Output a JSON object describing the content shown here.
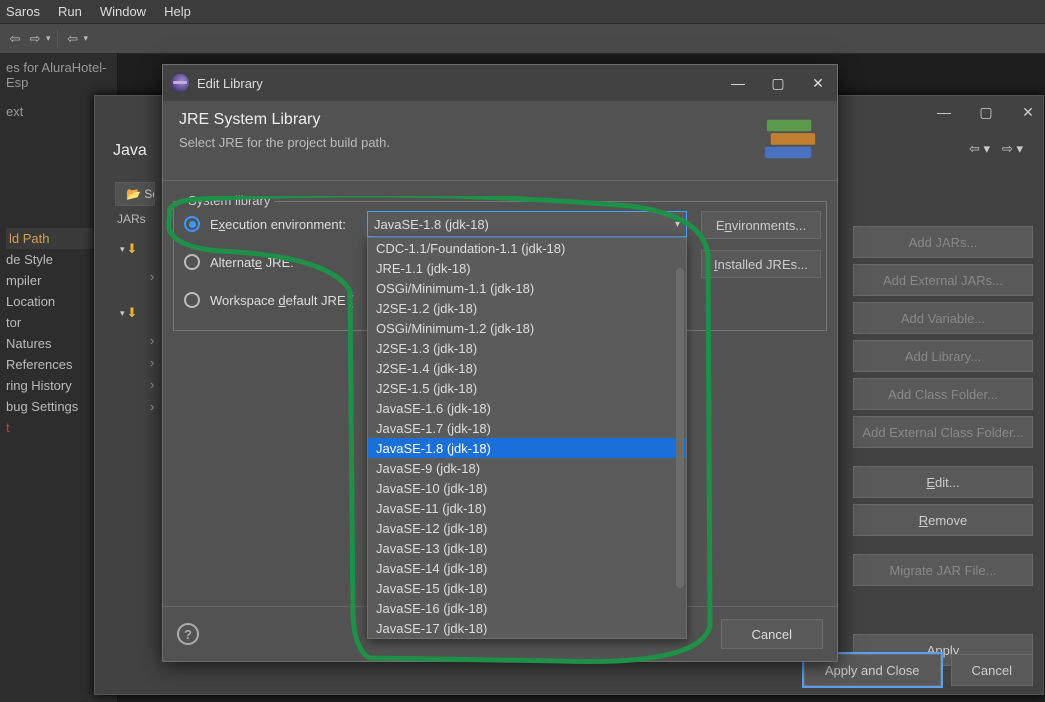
{
  "menubar": {
    "items": [
      "Saros",
      "Run",
      "Window",
      "Help"
    ]
  },
  "leftpanel": {
    "header1": "es for AluraHotel-Esp",
    "header2": "ext",
    "items": [
      "",
      "ld Path",
      "de Style",
      "mpiler",
      " Location",
      "tor",
      "Natures",
      "References",
      "ring History",
      "bug Settings"
    ],
    "marker": "t"
  },
  "bgwin": {
    "tablabel": "Java ",
    "srctab": "📂 Sc",
    "jarstxt": "JARs",
    "buttons": {
      "addjars": "Add JARs...",
      "addext": "Add External JARs...",
      "addvar": "Add Variable...",
      "addlib": "Add Library...",
      "addcls": "Add Class Folder...",
      "addextcls": "Add External Class Folder...",
      "edit": "Edit...",
      "remove": "Remove",
      "migrate": "Migrate JAR File..."
    },
    "applyclose": "Apply and Close",
    "cancel": "Cancel",
    "apply": "Apply"
  },
  "dlg": {
    "title": "Edit Library",
    "heading": "JRE System Library",
    "desc": "Select JRE for the project build path.",
    "fieldset": "System library",
    "radio1_pre": "E",
    "radio1_hot": "x",
    "radio1_post": "ecution environment:",
    "radio2_pre": "Alternat",
    "radio2_hot": "e",
    "radio2_post": " JRE:",
    "radio3_pre": "Workspace ",
    "radio3_hot": "d",
    "radio3_post": "efault JRE (",
    "combovalue": "JavaSE-1.8 (jdk-18)",
    "envbtn_pre": "E",
    "envbtn_hot": "n",
    "envbtn_post": "vironments...",
    "instbtn_pre": "",
    "instbtn_hot": "I",
    "instbtn_post": "nstalled JREs...",
    "options": [
      "CDC-1.1/Foundation-1.1 (jdk-18)",
      "JRE-1.1 (jdk-18)",
      "OSGi/Minimum-1.1 (jdk-18)",
      "J2SE-1.2 (jdk-18)",
      "OSGi/Minimum-1.2 (jdk-18)",
      "J2SE-1.3 (jdk-18)",
      "J2SE-1.4 (jdk-18)",
      "J2SE-1.5 (jdk-18)",
      "JavaSE-1.6 (jdk-18)",
      "JavaSE-1.7 (jdk-18)",
      "JavaSE-1.8 (jdk-18)",
      "JavaSE-9 (jdk-18)",
      "JavaSE-10 (jdk-18)",
      "JavaSE-11 (jdk-18)",
      "JavaSE-12 (jdk-18)",
      "JavaSE-13 (jdk-18)",
      "JavaSE-14 (jdk-18)",
      "JavaSE-15 (jdk-18)",
      "JavaSE-16 (jdk-18)",
      "JavaSE-17 (jdk-18)"
    ],
    "selected_index": 10,
    "cancel": "Cancel"
  }
}
